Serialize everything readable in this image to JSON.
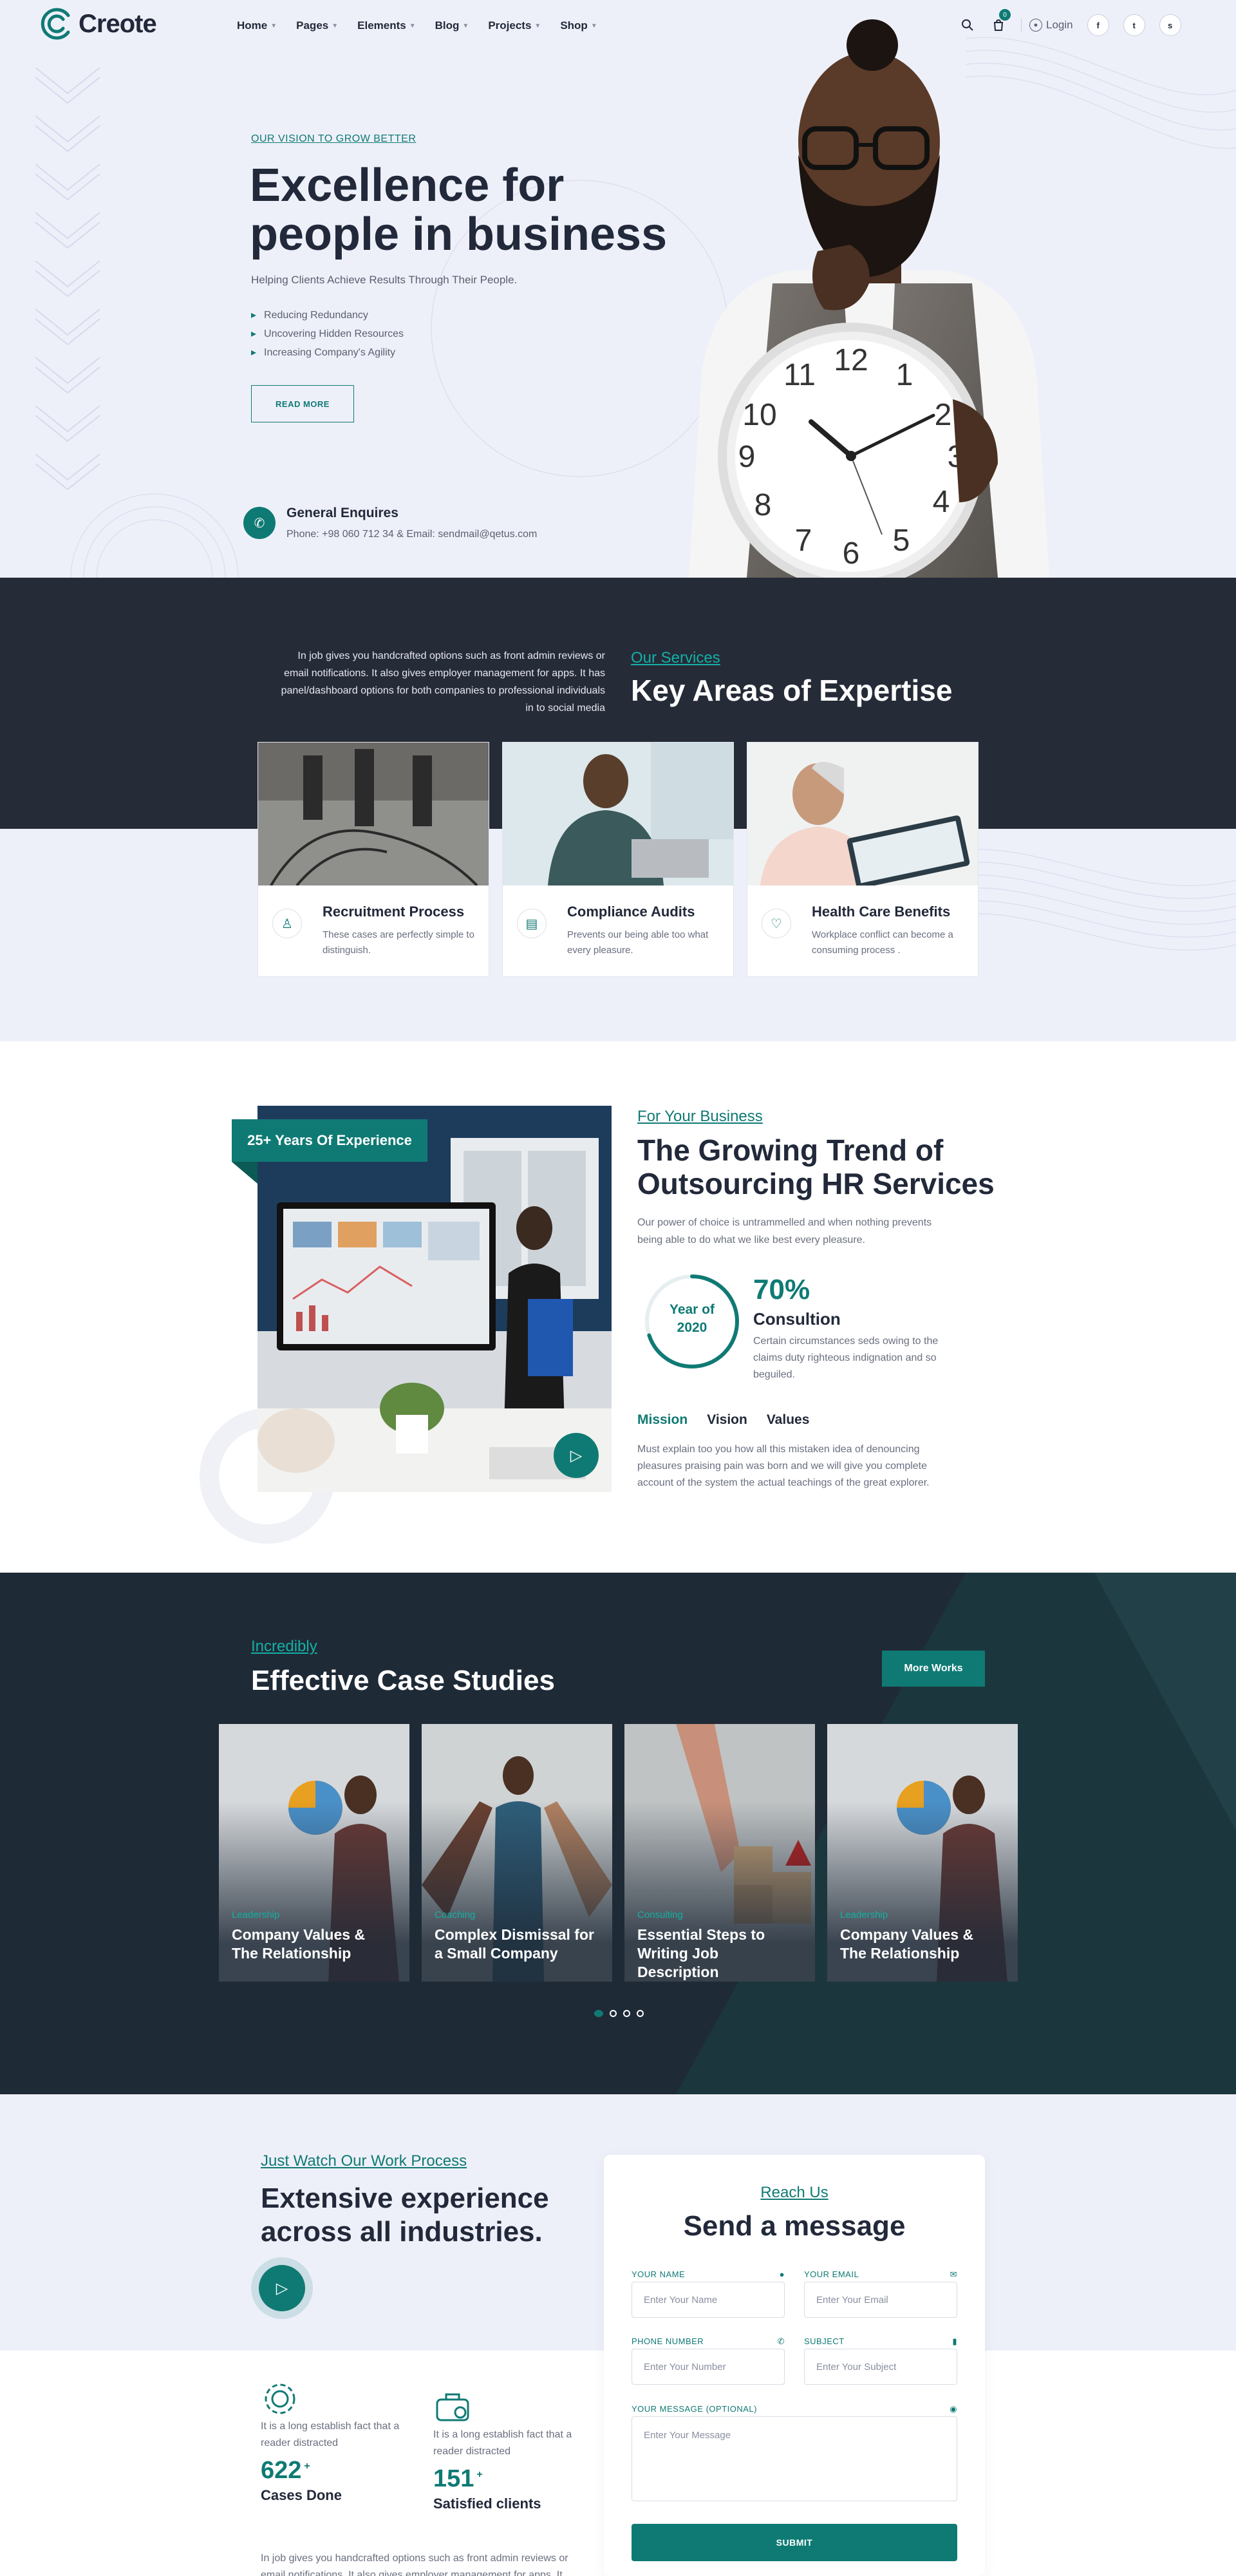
{
  "brand": {
    "name": "Creote"
  },
  "nav": [
    {
      "label": "Home"
    },
    {
      "label": "Pages"
    },
    {
      "label": "Elements"
    },
    {
      "label": "Blog"
    },
    {
      "label": "Projects"
    },
    {
      "label": "Shop"
    }
  ],
  "header": {
    "cart_count": "0",
    "login_label": "Login",
    "social": [
      "f",
      "t",
      "s"
    ]
  },
  "hero": {
    "tag": "OUR VISION TO GROW BETTER",
    "title_line1": "Excellence for",
    "title_line2": "people in business",
    "subtitle": "Helping Clients Achieve Results Through Their People.",
    "list": [
      "Reducing Redundancy",
      "Uncovering Hidden Resources",
      "Increasing Company's Agility"
    ],
    "button": "READ MORE",
    "enquiry_title": "General Enquires",
    "enquiry_text": "Phone: +98 060 712 34 & Email: sendmail@qetus.com"
  },
  "services": {
    "description": "In job gives you handcrafted options such as front admin reviews or email notifications. It also gives employer management for apps. It has panel/dashboard options for both companies to professional individuals in to social media",
    "tag": "Our Services",
    "title": "Key Areas of Expertise",
    "cards": [
      {
        "title": "Recruitment Process",
        "desc": "These cases are perfectly simple to distinguish."
      },
      {
        "title": "Compliance Audits",
        "desc": "Prevents our being able too what every pleasure."
      },
      {
        "title": "Health Care Benefits",
        "desc": "Workplace conflict can become a consuming process ."
      }
    ]
  },
  "trend": {
    "badge": "25+ Years Of Experience",
    "tag": "For Your Business",
    "title": "The Growing Trend of Outsourcing HR Services",
    "paragraph": "Our power of choice is untrammelled and when nothing prevents being able to do what we like best every pleasure.",
    "ring_line1": "Year of",
    "ring_line2": "2020",
    "percent": "70%",
    "percent_value": 70,
    "percent_label": "Consultion",
    "percent_desc": "Certain circumstances seds owing to the claims duty righteous indignation and so beguiled.",
    "tabs": [
      "Mission",
      "Vision",
      "Values"
    ],
    "tab_text": "Must explain too you how all this mistaken idea of denouncing pleasures praising pain was born and we will give you complete account of the system the actual teachings of the great explorer."
  },
  "cases": {
    "tag": "Incredibly",
    "title": "Effective Case Studies",
    "button": "More Works",
    "cards": [
      {
        "category": "Leadership",
        "title": "Company Values & The Relationship"
      },
      {
        "category": "Coaching",
        "title": "Complex Dismissal for a Small Company"
      },
      {
        "category": "Consulting",
        "title": "Essential Steps to Writing Job Description"
      },
      {
        "category": "Leadership",
        "title": "Company Values & The Relationship"
      }
    ]
  },
  "work": {
    "tag": "Just Watch Our Work Process",
    "title": "Extensive experience across all industries.",
    "stats": [
      {
        "desc": "It is a long establish fact that a reader distracted",
        "number": "622",
        "suffix": "+",
        "label": "Cases Done"
      },
      {
        "desc": "It is a long establish fact that a reader distracted",
        "number": "151",
        "suffix": "+",
        "label": "Satisfied clients"
      }
    ],
    "paragraph": "In job gives you handcrafted options such as front admin reviews or email notifications. It also gives employer management for apps. It"
  },
  "form": {
    "tag": "Reach Us",
    "title": "Send a message",
    "name_label": "YOUR NAME",
    "name_placeholder": "Enter Your Name",
    "email_label": "YOUR EMAIL",
    "email_placeholder": "Enter Your Email",
    "phone_label": "PHONE NUMBER",
    "phone_placeholder": "Enter Your Number",
    "subject_label": "SUBJECT",
    "subject_placeholder": "Enter Your Subject",
    "message_label": "YOUR MESSAGE (OPTIONAL)",
    "message_placeholder": "Enter Your Message",
    "submit": "SUBMIT"
  },
  "colors": {
    "accent": "#0f7a74",
    "accent_light": "#13b0a5",
    "dark": "#262b38",
    "text": "#22293a",
    "bg": "#eef0f9"
  }
}
